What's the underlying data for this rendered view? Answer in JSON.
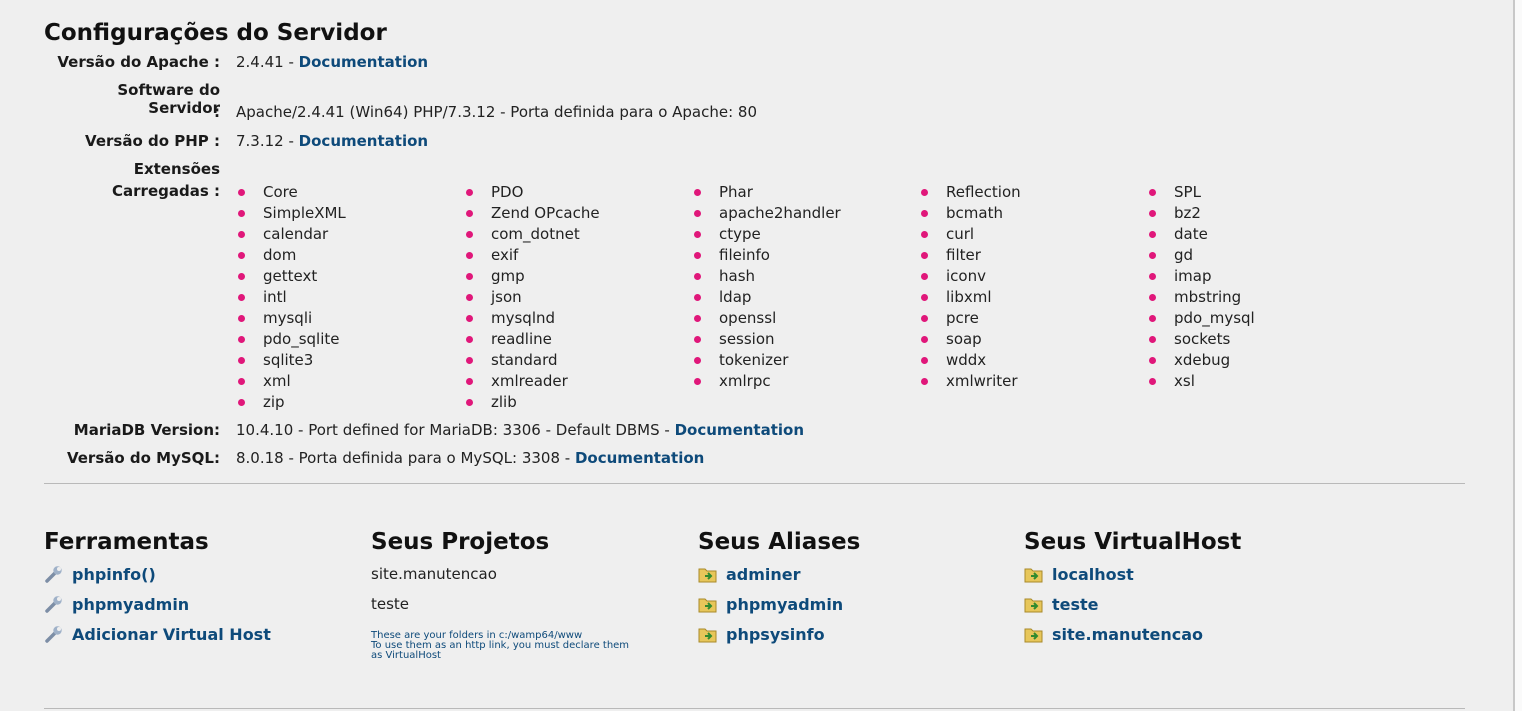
{
  "server": {
    "title": "Configurações do Servidor",
    "apache": {
      "label": "Versão do Apache :",
      "value": "2.4.41  - ",
      "link": "Documentation"
    },
    "software": {
      "label_line1": "Software do Servidor",
      "label_line2": ":",
      "value": "Apache/2.4.41 (Win64) PHP/7.3.12 - Porta definida para o Apache: 80"
    },
    "php": {
      "label": "Versão do PHP :",
      "value": "7.3.12  - ",
      "link": "Documentation"
    },
    "extensions": {
      "label_line1": "Extensões",
      "label_line2": "Carregadas :",
      "columns": [
        [
          "Core",
          "SimpleXML",
          "calendar",
          "dom",
          "gettext",
          "intl",
          "mysqli",
          "pdo_sqlite",
          "sqlite3",
          "xml",
          "zip"
        ],
        [
          "PDO",
          "Zend OPcache",
          "com_dotnet",
          "exif",
          "gmp",
          "json",
          "mysqlnd",
          "readline",
          "standard",
          "xmlreader",
          "zlib"
        ],
        [
          "Phar",
          "apache2handler",
          "ctype",
          "fileinfo",
          "hash",
          "ldap",
          "openssl",
          "session",
          "tokenizer",
          "xmlrpc"
        ],
        [
          "Reflection",
          "bcmath",
          "curl",
          "filter",
          "iconv",
          "libxml",
          "pcre",
          "soap",
          "wddx",
          "xmlwriter"
        ],
        [
          "SPL",
          "bz2",
          "date",
          "gd",
          "imap",
          "mbstring",
          "pdo_mysql",
          "sockets",
          "xdebug",
          "xsl"
        ]
      ]
    },
    "mariadb": {
      "label": "MariaDB Version:",
      "value": "10.4.10 - Port defined for MariaDB: 3306 - Default DBMS - ",
      "link": "Documentation"
    },
    "mysql": {
      "label": "Versão do MySQL:",
      "value": "8.0.18 - Porta definida para o MySQL: 3308 - ",
      "link": "Documentation"
    }
  },
  "tools": {
    "title": "Ferramentas",
    "items": [
      "phpinfo()",
      "phpmyadmin",
      "Adicionar Virtual Host"
    ]
  },
  "projects": {
    "title": "Seus Projetos",
    "items": [
      "site.manutencao",
      "teste"
    ],
    "note_line1": "These are your folders in c:/wamp64/www",
    "note_line2": "To use them as an http link, you must declare them",
    "note_line3": "as VirtualHost"
  },
  "aliases": {
    "title": "Seus Aliases",
    "items": [
      "adminer",
      "phpmyadmin",
      "phpsysinfo"
    ]
  },
  "virtualhosts": {
    "title": "Seus VirtualHost",
    "items": [
      "localhost",
      "teste",
      "site.manutencao"
    ]
  },
  "colors": {
    "background": "#efefef",
    "link": "#0e4a7a",
    "bullet": "#e0177a"
  }
}
